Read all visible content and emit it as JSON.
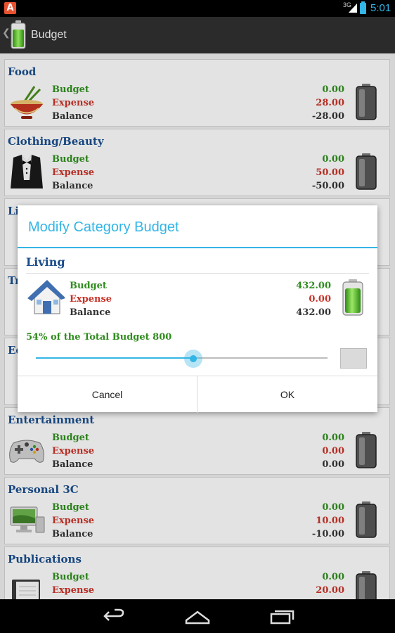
{
  "status_bar": {
    "app_badge": "A",
    "network": "3G",
    "time": "5:01",
    "icons": [
      "app-notification-icon",
      "signal-icon",
      "battery-charging-icon"
    ]
  },
  "action_bar": {
    "title": "Budget",
    "icons": [
      "back-caret-icon",
      "battery-app-icon"
    ]
  },
  "categories": [
    {
      "name": "Food",
      "icon": "noodle-bowl-icon",
      "budget_label": "Budget",
      "expense_label": "Expense",
      "balance_label": "Balance",
      "budget": "0.00",
      "expense": "28.00",
      "balance": "-28.00",
      "battery_level": 0
    },
    {
      "name": "Clothing/Beauty",
      "icon": "tuxedo-icon",
      "budget_label": "Budget",
      "expense_label": "Expense",
      "balance_label": "Balance",
      "budget": "0.00",
      "expense": "50.00",
      "balance": "-50.00",
      "battery_level": 0
    },
    {
      "name": "Entertainment",
      "icon": "gamepad-icon",
      "budget_label": "Budget",
      "expense_label": "Expense",
      "balance_label": "Balance",
      "budget": "0.00",
      "expense": "0.00",
      "balance": "0.00",
      "battery_level": 0
    },
    {
      "name": "Personal 3C",
      "icon": "computer-icon",
      "budget_label": "Budget",
      "expense_label": "Expense",
      "balance_label": "Balance",
      "budget": "0.00",
      "expense": "10.00",
      "balance": "-10.00",
      "battery_level": 0
    },
    {
      "name": "Publications",
      "icon": "planner-book-icon",
      "budget_label": "Budget",
      "expense_label": "Expense",
      "budget": "0.00",
      "expense": "20.00",
      "battery_level": 0
    }
  ],
  "hidden_category_fragments": [
    "Li",
    "Tr",
    "Ed"
  ],
  "dialog": {
    "title": "Modify Category Budget",
    "category": "Living",
    "icon": "house-icon",
    "budget_label": "Budget",
    "expense_label": "Expense",
    "balance_label": "Balance",
    "budget": "432.00",
    "expense": "0.00",
    "balance": "432.00",
    "battery_level": 1.0,
    "percent_text": "54% of the Total Budget 800",
    "slider_value": 0.54,
    "cancel_label": "Cancel",
    "ok_label": "OK"
  },
  "colors": {
    "accent": "#33b5e5",
    "budget_green": "#2f8c1e",
    "expense_red": "#c53329",
    "category_blue": "#1a4c8a"
  },
  "nav_bar": {
    "icons": [
      "back-nav-icon",
      "home-nav-icon",
      "recent-apps-icon"
    ]
  }
}
